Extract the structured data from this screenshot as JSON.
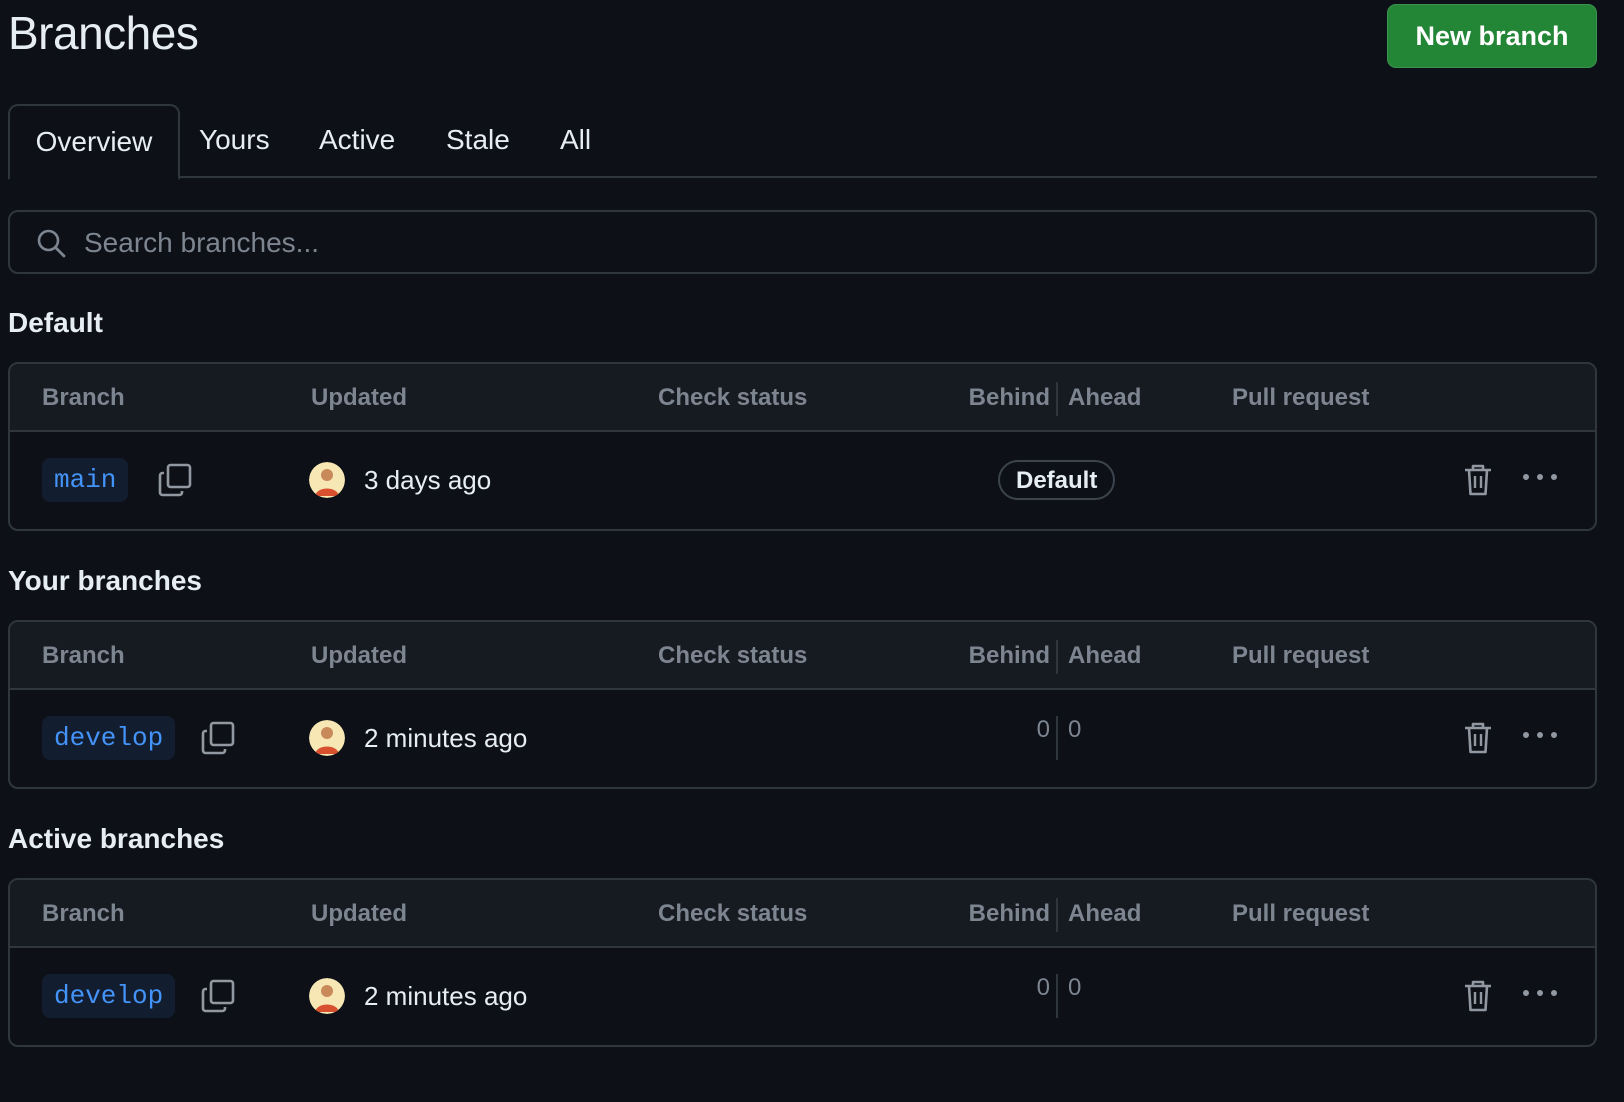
{
  "page": {
    "title": "Branches",
    "new_branch_label": "New branch"
  },
  "tabs": [
    {
      "label": "Overview",
      "selected": true
    },
    {
      "label": "Yours",
      "selected": false
    },
    {
      "label": "Active",
      "selected": false
    },
    {
      "label": "Stale",
      "selected": false
    },
    {
      "label": "All",
      "selected": false
    }
  ],
  "search": {
    "placeholder": "Search branches...",
    "value": ""
  },
  "columns": {
    "branch": "Branch",
    "updated": "Updated",
    "check_status": "Check status",
    "behind": "Behind",
    "ahead": "Ahead",
    "pull_request": "Pull request"
  },
  "sections": [
    {
      "title": "Default",
      "rows": [
        {
          "branch": "main",
          "updated": "3 days ago",
          "badge": "Default",
          "behind": "",
          "ahead": ""
        }
      ]
    },
    {
      "title": "Your branches",
      "rows": [
        {
          "branch": "develop",
          "updated": "2 minutes ago",
          "badge": "",
          "behind": "0",
          "ahead": "0"
        }
      ]
    },
    {
      "title": "Active branches",
      "rows": [
        {
          "branch": "develop",
          "updated": "2 minutes ago",
          "badge": "",
          "behind": "0",
          "ahead": "0"
        }
      ]
    }
  ],
  "icons": {
    "search": "search-icon",
    "copy": "copy-icon",
    "avatar": "user-avatar",
    "delete": "trash-icon",
    "more": "kebab-horizontal-icon"
  },
  "colors": {
    "background": "#0d1117",
    "primary_button": "#238636",
    "branch_text": "#4493f8",
    "border": "#30363d",
    "muted_text": "#7d8590"
  }
}
